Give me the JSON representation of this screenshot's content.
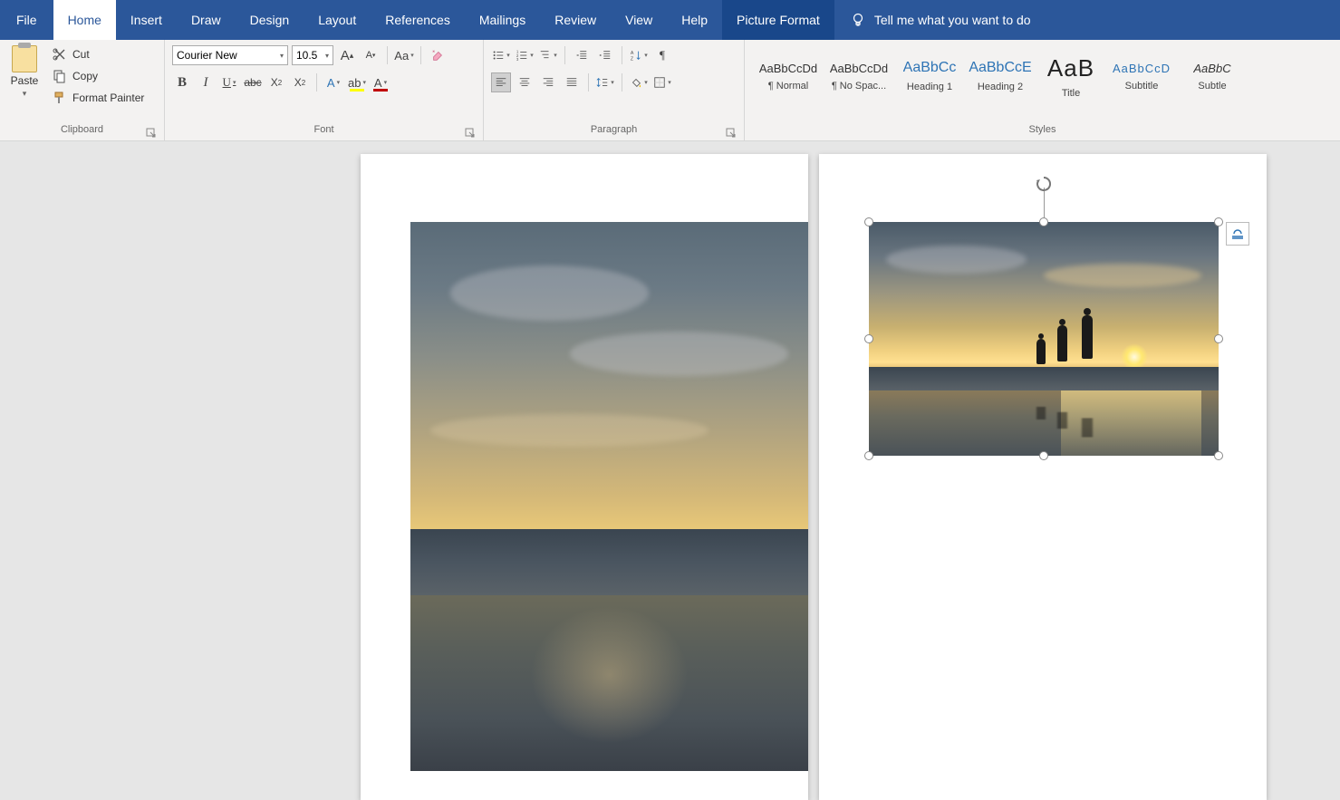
{
  "menubar": {
    "tabs": [
      {
        "label": "File"
      },
      {
        "label": "Home"
      },
      {
        "label": "Insert"
      },
      {
        "label": "Draw"
      },
      {
        "label": "Design"
      },
      {
        "label": "Layout"
      },
      {
        "label": "References"
      },
      {
        "label": "Mailings"
      },
      {
        "label": "Review"
      },
      {
        "label": "View"
      },
      {
        "label": "Help"
      },
      {
        "label": "Picture Format"
      }
    ],
    "active_tab": "Home",
    "contextual_tab": "Picture Format",
    "tell_me_placeholder": "Tell me what you want to do"
  },
  "ribbon": {
    "clipboard": {
      "group_label": "Clipboard",
      "paste_label": "Paste",
      "cut_label": "Cut",
      "copy_label": "Copy",
      "format_painter_label": "Format Painter"
    },
    "font": {
      "group_label": "Font",
      "font_name": "Courier New",
      "font_size": "10.5"
    },
    "paragraph": {
      "group_label": "Paragraph"
    },
    "styles": {
      "group_label": "Styles",
      "items": [
        {
          "sample": "AaBbCcDd",
          "name": "¶ Normal",
          "class": ""
        },
        {
          "sample": "AaBbCcDd",
          "name": "¶ No Spac...",
          "class": ""
        },
        {
          "sample": "AaBbCc",
          "name": "Heading 1",
          "class": "heading"
        },
        {
          "sample": "AaBbCcE",
          "name": "Heading 2",
          "class": "heading"
        },
        {
          "sample": "AaB",
          "name": "Title",
          "class": "title"
        },
        {
          "sample": "AaBbCcD",
          "name": "Subtitle",
          "class": "subtitle"
        },
        {
          "sample": "AaBbC",
          "name": "Subtle",
          "class": "emphasis"
        }
      ]
    }
  },
  "colors": {
    "ribbon_bg": "#2b579a",
    "highlight": "#ffff00",
    "font_color": "#c00000",
    "heading_color": "#2e74b5"
  }
}
